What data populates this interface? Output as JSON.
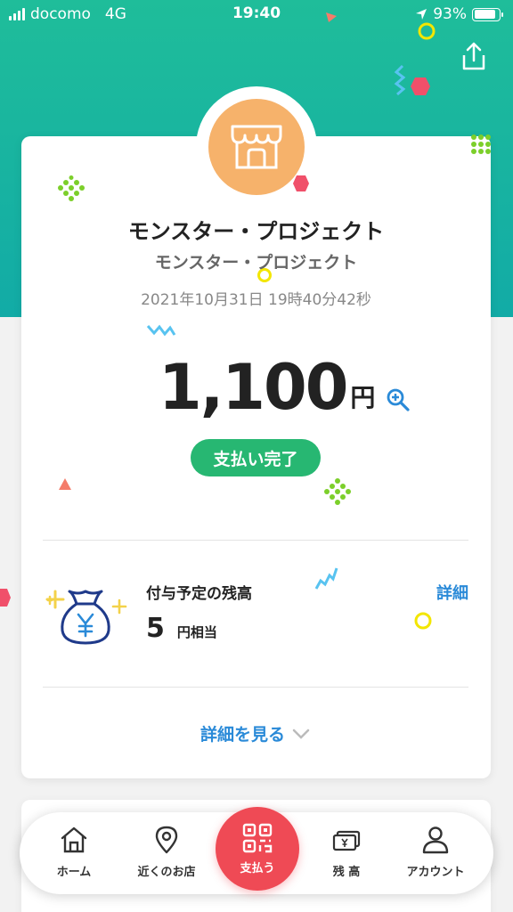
{
  "status_bar": {
    "carrier": "docomo",
    "network": "4G",
    "time": "19:40",
    "battery": "93%"
  },
  "payment": {
    "merchant_name": "モンスター・プロジェクト",
    "merchant_sub": "モンスター・プロジェクト",
    "datetime": "2021年10月31日 19時40分42秒",
    "amount": "1,100",
    "currency": "円",
    "status": "支払い完了"
  },
  "points": {
    "label": "付与予定の残高",
    "value": "5",
    "unit": "円相当",
    "detail_link": "詳細"
  },
  "see_more": "詳細を見る",
  "tabbar": {
    "home": "ホーム",
    "nearby": "近くのお店",
    "pay": "支払う",
    "balance": "残 高",
    "account": "アカウント"
  },
  "colors": {
    "header_teal": "#1fbd9a",
    "store_orange": "#f6b26b",
    "status_green": "#27b772",
    "link_blue": "#2a8ad8",
    "pay_red": "#ef4a55"
  },
  "icons": [
    "share-icon",
    "store-icon",
    "zoom-in-icon",
    "money-bag-icon",
    "chevron-down-icon",
    "home-icon",
    "location-pin-icon",
    "qr-code-icon",
    "wallet-icon",
    "person-icon"
  ]
}
